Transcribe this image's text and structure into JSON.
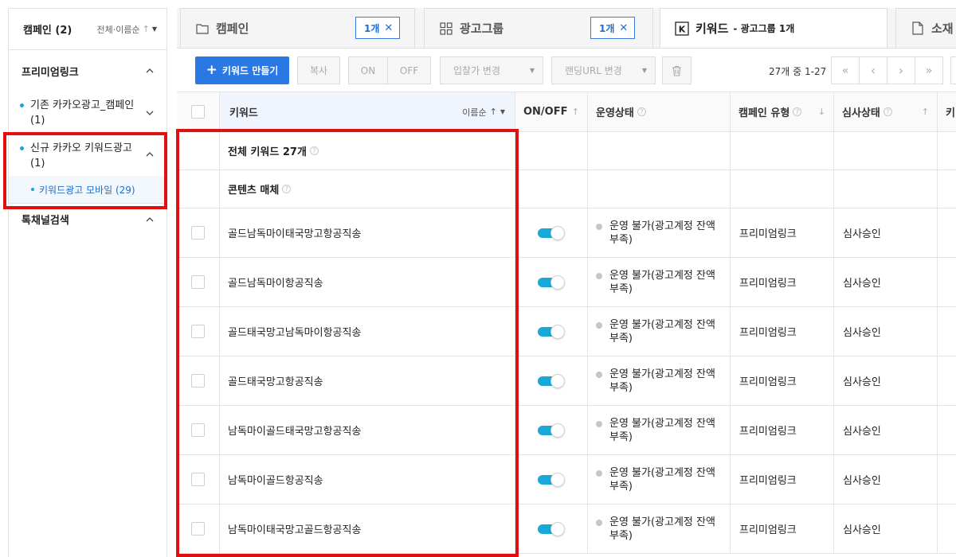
{
  "sidebar": {
    "title": "캠페인 (2)",
    "sort_label": "전체·이름순",
    "sort_arrow": "↑",
    "sections": [
      {
        "label": "프리미엄링크"
      },
      {
        "label": "톡채널검색"
      }
    ],
    "items": [
      {
        "line1": "기존 카카오광고_캠페인",
        "line2": "(1)"
      },
      {
        "line1": "신규 카카오 키워드광고",
        "line2": "(1)"
      }
    ],
    "sub_item": "키워드광고 모바일 (29)"
  },
  "tabs": [
    {
      "label": "캠페인",
      "icon": "folder-icon",
      "chip": "1개"
    },
    {
      "label": "광고그룹",
      "icon": "grid-icon",
      "chip": "1개"
    },
    {
      "label": "키워드",
      "icon": "k-icon",
      "sub": "- 광고그룹 1개"
    },
    {
      "label": "소재",
      "icon": "document-icon"
    }
  ],
  "toolbar": {
    "create": "키워드 만들기",
    "copy": "복사",
    "on": "ON",
    "off": "OFF",
    "bid": "입찰가 변경",
    "landing": "랜딩URL 변경",
    "count": "27개 중 1-27",
    "first": "«",
    "prev": "‹",
    "next": "›",
    "last": "»"
  },
  "table": {
    "headers": {
      "keyword": "키워드",
      "keyword_sort": "이름순",
      "keyword_sort_arrow": "↑",
      "onoff": "ON/OFF",
      "status": "운영상태",
      "campaign_type": "캠페인 유형",
      "review": "심사상태",
      "next": "키"
    },
    "summary_total": "전체 키워드 27개",
    "summary_media": "콘텐츠 매체",
    "rows": [
      {
        "keyword": "골드남독마이태국망고항공직송",
        "status1": "운영 불가(광고계정 잔액",
        "status2": "부족)",
        "type": "프리미엄링크",
        "review": "심사승인"
      },
      {
        "keyword": "골드남독마이항공직송",
        "status1": "운영 불가(광고계정 잔액",
        "status2": "부족)",
        "type": "프리미엄링크",
        "review": "심사승인"
      },
      {
        "keyword": "골드태국망고남독마이항공직송",
        "status1": "운영 불가(광고계정 잔액",
        "status2": "부족)",
        "type": "프리미엄링크",
        "review": "심사승인"
      },
      {
        "keyword": "골드태국망고항공직송",
        "status1": "운영 불가(광고계정 잔액",
        "status2": "부족)",
        "type": "프리미엄링크",
        "review": "심사승인"
      },
      {
        "keyword": "남독마이골드태국망고항공직송",
        "status1": "운영 불가(광고계정 잔액",
        "status2": "부족)",
        "type": "프리미엄링크",
        "review": "심사승인"
      },
      {
        "keyword": "남독마이골드항공직송",
        "status1": "운영 불가(광고계정 잔액",
        "status2": "부족)",
        "type": "프리미엄링크",
        "review": "심사승인"
      },
      {
        "keyword": "남독마이태국망고골드항공직송",
        "status1": "운영 불가(광고계정 잔액",
        "status2": "부족)",
        "type": "프리미엄링크",
        "review": "심사승인"
      }
    ]
  },
  "colors": {
    "primary": "#2a78e4",
    "toggle_on": "#19a8d8",
    "highlight": "#e01010",
    "sub_item_text": "#1f6fd1"
  }
}
